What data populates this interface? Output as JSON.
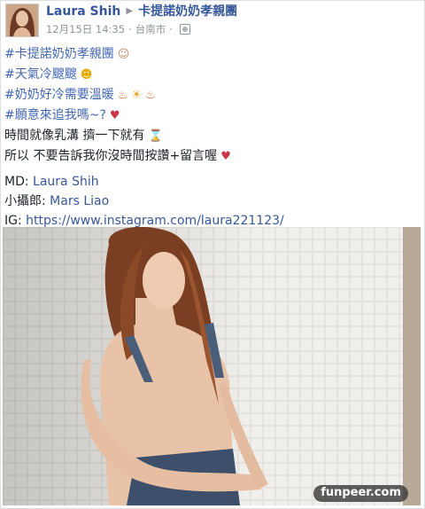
{
  "header": {
    "author": "Laura Shih",
    "group": "卡提諾奶奶孝親團",
    "date": "12月15日 14:35",
    "location": "台南市"
  },
  "post": {
    "tag1": "#卡提諾奶奶孝親團",
    "tag2": "#天氣冷颼颼",
    "tag3": "#奶奶好冷需要溫暖",
    "tag4": "#願意來追我嗎~?",
    "line5": "時間就像乳溝 擠一下就有",
    "line6": "所以 不要告訴我你沒時間按讚+留言喔",
    "md_label": "MD: ",
    "md_value": "Laura Shih",
    "photographer_label": "小攝郎: ",
    "photographer_value": "Mars Liao",
    "ig_label": "IG: ",
    "ig_value": "https://www.instagram.com/laura221123/"
  },
  "icons": {
    "face": "old-person-emoji",
    "smile": "smile-emoji",
    "fire": "fire-emoji",
    "sun": "sun-emoji",
    "lips": "lips-emoji",
    "hourglass": "hourglass-emoji",
    "globe": "globe-icon"
  },
  "photo": {
    "watermark": "funpeer.com"
  },
  "colors": {
    "link": "#365899",
    "meta": "#90949c"
  }
}
